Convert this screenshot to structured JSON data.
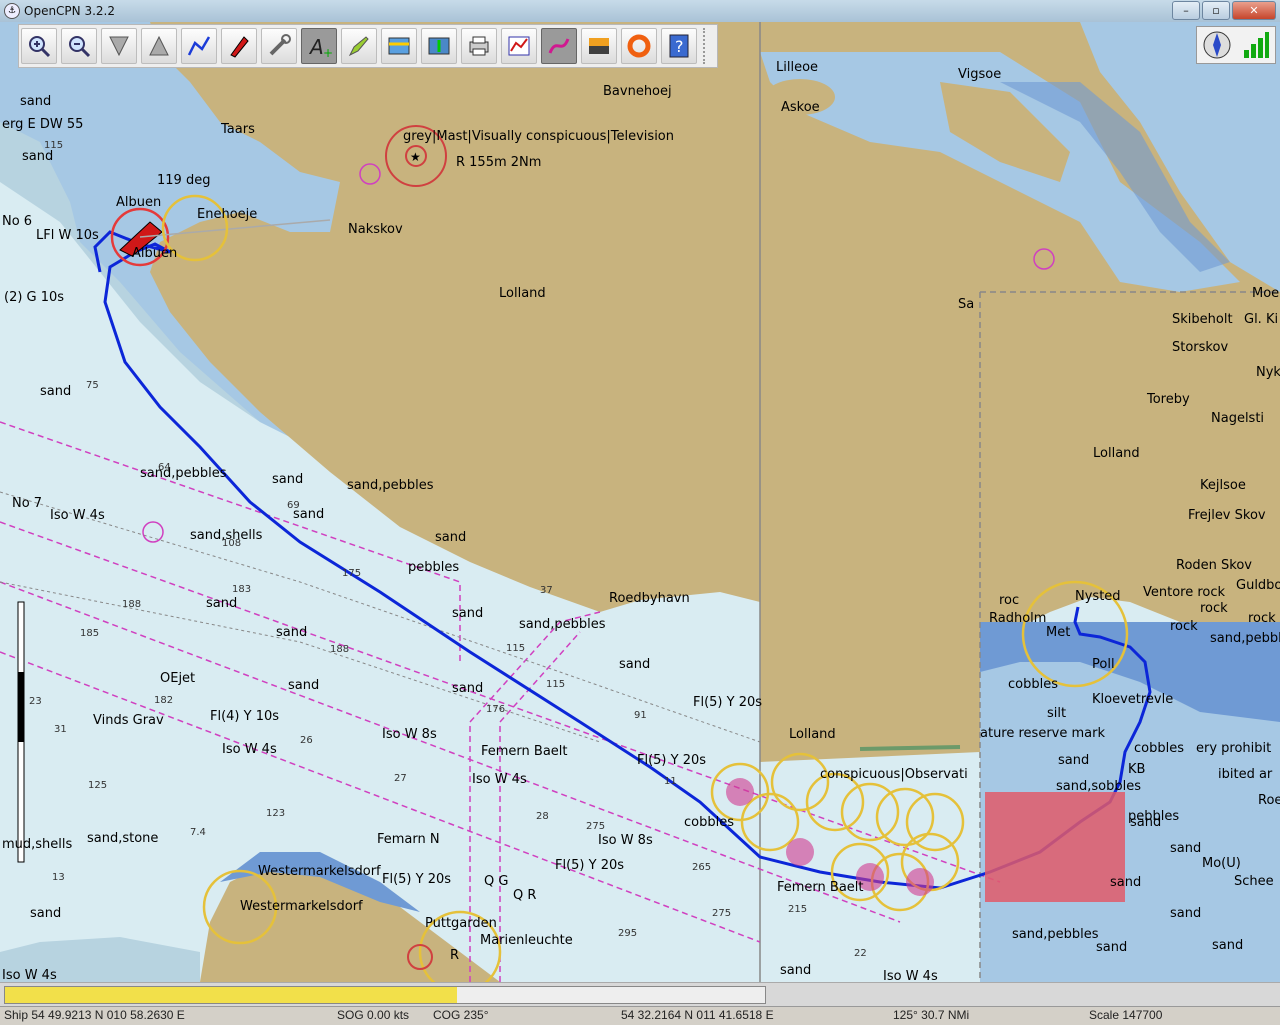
{
  "window": {
    "title": "OpenCPN 3.2.2",
    "min": "–",
    "max": "▫",
    "close": "✕"
  },
  "toolbar": {
    "tools": [
      "zoom-in-tool",
      "zoom-out-tool",
      "scale-in-tool",
      "scale-out-tool",
      "route-tool",
      "ship-tool",
      "measure-tool",
      "text-tool",
      "waypoint-tool",
      "tide-tool",
      "current-tool",
      "print-tool",
      "route-manager-tool",
      "track-tool",
      "color-scheme-tool",
      "mob-tool",
      "help-tool"
    ]
  },
  "map": {
    "colors": {
      "deep": "#d9ecf2",
      "shallow": "#a6c8e4",
      "blue": "#6f9ad4",
      "land": "#c8b37e",
      "intertidal": "#b7c9a4",
      "route": "#0c26d8"
    },
    "labels": {
      "lilleoe": "Lilleoe",
      "vigsoe": "Vigsoe",
      "bavnehoej": "Bavnehoej",
      "askoe": "Askoe",
      "taars": "Taars",
      "mast": "grey|Mast|Visually conspicuous|Television",
      "mast_light": "R 155m 2Nm",
      "heading": "119 deg",
      "albuen": "Albuen",
      "albuen2": "Albuen",
      "enehoeje": "Enehoeje",
      "nakskov": "Nakskov",
      "lolland": "Lolland",
      "lolland2": "Lolland",
      "lolland3": "Lolland",
      "sa": "Sa",
      "moe": "Moe",
      "skibeholt": "Skibeholt",
      "glki": "Gl. Ki",
      "storskov": "Storskov",
      "nyk": "Nyk",
      "toreby": "Toreby",
      "nagelsti": "Nagelsti",
      "kejlsoe": "Kejlsoe",
      "frejlev": "Frejlev Skov",
      "roden": "Roden Skov",
      "guldbo": "Guldbo",
      "edge_top": "erg E DW 55",
      "sand1": "sand",
      "sand2": "sand",
      "no6": "No 6",
      "lfl": "LFl W 10s",
      "g10s": "(2) G 10s",
      "sand3": "sand",
      "no7": "No 7",
      "isow4s": "Iso W 4s",
      "sandpebbles1": "sand,pebbles",
      "sand4": "sand",
      "sandpebbles2": "sand,pebbles",
      "sand5": "sand",
      "sandshells": "sand,shells",
      "sand6": "sand",
      "pebbles": "pebbles",
      "sand7": "sand",
      "sand8": "sand",
      "roedbyhavn": "Roedbyhavn",
      "sandpebbles3": "sand,pebbles",
      "sand9": "sand",
      "sand10": "sand",
      "sand11": "sand",
      "oejet": "OEjet",
      "vindsgrav": "Vinds Grav",
      "fl4": "Fl(4) Y 10s",
      "isow4s2": "Iso W 4s",
      "isow8s": "Iso W 8s",
      "femernbaelt": "Femern Baelt",
      "isow4s3": "Iso W 4s",
      "fl5y20s": "Fl(5) Y 20s",
      "fl5y20s2": "Fl(5) Y 20s",
      "cobbles": "cobbles",
      "conspicuous": "conspicuous|Observati",
      "lolland4": "Lolland",
      "sandstone": "sand,stone",
      "mudshells": "mud,shells",
      "femarnn": "Femarn N",
      "westermarkelsdorf": "Westermarkelsdorf",
      "westermarkelsdorf2": "Westermarkelsdorf",
      "fl5y20s3": "Fl(5) Y 20s",
      "og": "Q G",
      "qr": "Q R",
      "isow8s2": "Iso W 8s",
      "fl5y20s4": "Fl(5) Y 20s",
      "puttgarden": "Puttgarden",
      "marienleuchte": "Marienleuchte",
      "sand12": "sand",
      "isow4s4": "Iso W 4s",
      "lys": "Iso W 4s",
      "femernbaelt2": "Femern Baelt",
      "sand13": "sand",
      "nysted": "Nysted",
      "roc": "roc",
      "radholm": "Radholm",
      "metro": "Met",
      "poll": "Poll",
      "cobbles2": "cobbles",
      "kloeve": "Kloevetrevle",
      "silt": "silt",
      "nature": "ature reserve mark",
      "sand14": "sand",
      "sandsobbles": "sand,sobbles",
      "cobbles3": "cobbles",
      "prohibit": "ery prohibit",
      "pebbles2": "pebbles",
      "ventore": "Ventore rock",
      "rock": "rock",
      "rock2": "rock",
      "sandpebbles4": "sand,pebble",
      "rock3": "rock",
      "sand15": "sand",
      "sandpebbles5": "sand,pebbles",
      "sand16": "sand",
      "sand17": "sand",
      "sand18": "sand",
      "schee": "Schee",
      "mo": "Mo(U)",
      "rooe": "Roe",
      "lprohib": "ibited ar",
      "sand19": "sand",
      "sand20": "sand",
      "sand21": "sand",
      "vr": "R",
      "kb": "KB"
    },
    "depths": [
      "115",
      "75",
      "64",
      "69",
      "108",
      "175",
      "183",
      "188",
      "185",
      "182",
      "176",
      "23",
      "26",
      "123",
      "31",
      "27",
      "28",
      "275",
      "265",
      "215",
      "275",
      "295",
      "22",
      "11",
      "115",
      "115",
      "37",
      "91",
      "188",
      "125",
      "7.4",
      "13"
    ]
  },
  "progress": {
    "value_pct": 59.5
  },
  "status": {
    "ship": "Ship 54 49.9213 N   010 58.2630 E",
    "sog": "SOG 0.00 kts",
    "cog": "COG 235°",
    "cursor": "54 32.2164 N   011 41.6518 E",
    "bearing": "125°   30.7 NMi",
    "scale": "Scale 147700"
  }
}
